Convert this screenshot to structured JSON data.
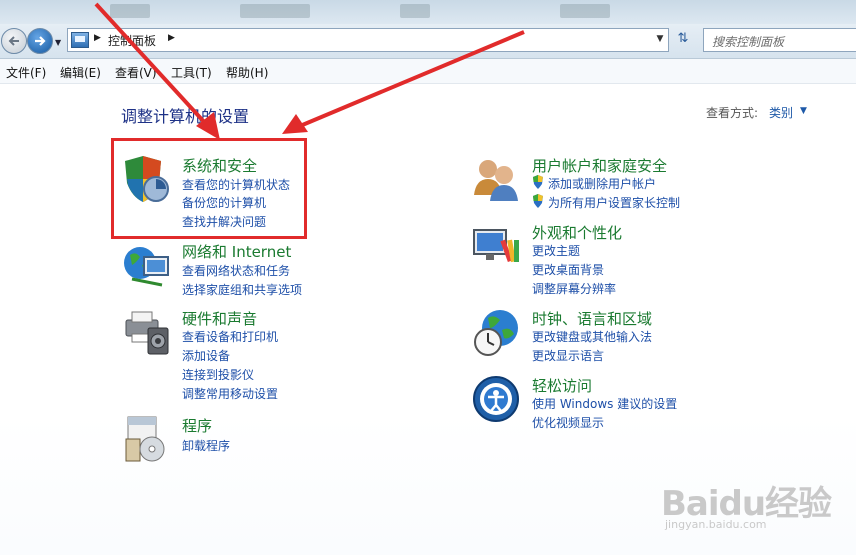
{
  "address": {
    "breadcrumb": "控制面板"
  },
  "search": {
    "placeholder": "搜索控制面板"
  },
  "menu": [
    "文件(F)",
    "编辑(E)",
    "查看(V)",
    "工具(T)",
    "帮助(H)"
  ],
  "heading": "调整计算机的设置",
  "view_by": {
    "label": "查看方式:",
    "value": "类别"
  },
  "categories": {
    "system_security": {
      "title": "系统和安全",
      "links": [
        "查看您的计算机状态",
        "备份您的计算机",
        "查找并解决问题"
      ]
    },
    "network": {
      "title": "网络和 Internet",
      "links": [
        "查看网络状态和任务",
        "选择家庭组和共享选项"
      ]
    },
    "hardware": {
      "title": "硬件和声音",
      "links": [
        "查看设备和打印机",
        "添加设备",
        "连接到投影仪",
        "调整常用移动设置"
      ]
    },
    "programs": {
      "title": "程序",
      "links": [
        "卸载程序"
      ]
    },
    "user_accounts": {
      "title": "用户帐户和家庭安全",
      "links": [
        "添加或删除用户帐户",
        "为所有用户设置家长控制"
      ]
    },
    "appearance": {
      "title": "外观和个性化",
      "links": [
        "更改主题",
        "更改桌面背景",
        "调整屏幕分辨率"
      ]
    },
    "clock": {
      "title": "时钟、语言和区域",
      "links": [
        "更改键盘或其他输入法",
        "更改显示语言"
      ]
    },
    "ease": {
      "title": "轻松访问",
      "links": [
        "使用 Windows 建议的设置",
        "优化视频显示"
      ]
    }
  },
  "watermark": {
    "logo": "Baidu经验",
    "url": "jingyan.baidu.com"
  },
  "icons": [
    "back-icon",
    "forward-icon",
    "control-panel-icon",
    "refresh-icon",
    "shield-icon",
    "network-globe-icon",
    "printer-icon",
    "programs-icon",
    "users-icon",
    "monitor-palette-icon",
    "clock-globe-icon",
    "accessibility-icon"
  ],
  "colors": {
    "link": "#1e4fa8",
    "category_title": "#1a7a30",
    "heading": "#1e3287",
    "annotation": "#e12b2b"
  }
}
